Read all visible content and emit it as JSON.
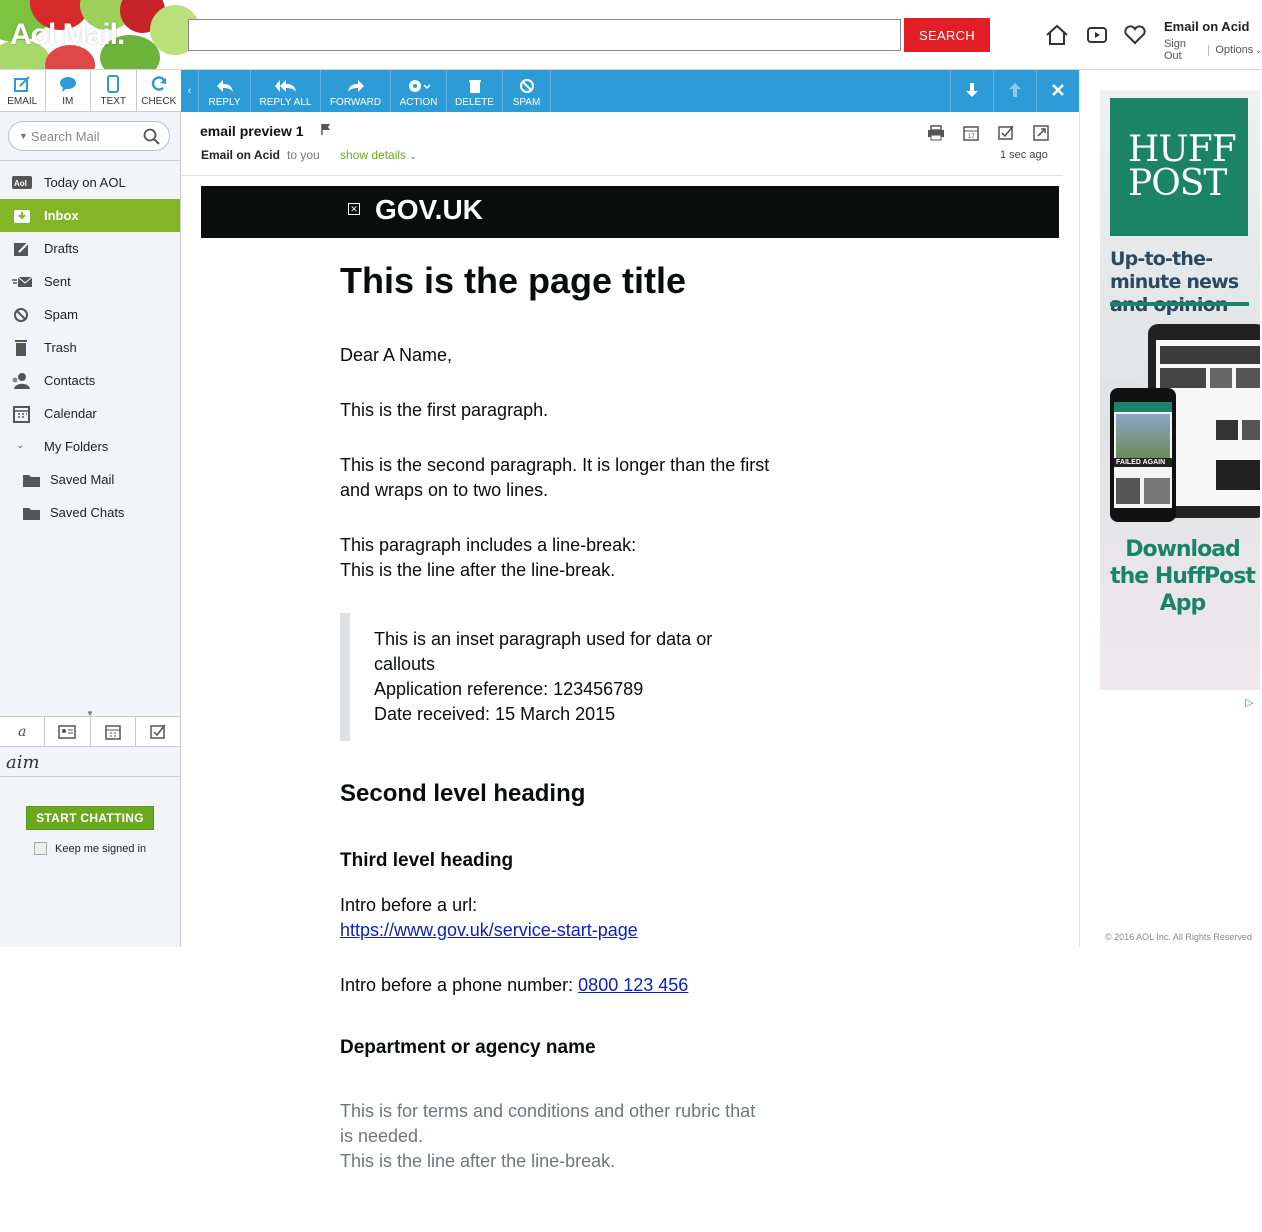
{
  "header": {
    "logo_text": "Aol Mail.",
    "search_button": "SEARCH",
    "search_value": "",
    "user_name": "Email on Acid",
    "sign_out": "Sign Out",
    "options": "Options"
  },
  "compose": [
    {
      "label": "EMAIL",
      "icon": "compose-icon"
    },
    {
      "label": "IM",
      "icon": "chat-bubble-icon"
    },
    {
      "label": "TEXT",
      "icon": "phone-icon"
    },
    {
      "label": "CHECK",
      "icon": "refresh-icon"
    }
  ],
  "toolbar": {
    "reply": "REPLY",
    "reply_all": "REPLY ALL",
    "forward": "FORWARD",
    "action": "ACTION",
    "delete": "DELETE",
    "spam": "SPAM"
  },
  "sidebar": {
    "search_placeholder": "Search Mail",
    "items": [
      {
        "label": "Today on AOL",
        "icon": "aol-icon"
      },
      {
        "label": "Inbox",
        "icon": "inbox-icon",
        "active": true
      },
      {
        "label": "Drafts",
        "icon": "drafts-icon"
      },
      {
        "label": "Sent",
        "icon": "sent-icon"
      },
      {
        "label": "Spam",
        "icon": "spam-icon"
      },
      {
        "label": "Trash",
        "icon": "trash-icon"
      },
      {
        "label": "Contacts",
        "icon": "contacts-icon"
      },
      {
        "label": "Calendar",
        "icon": "calendar-icon"
      },
      {
        "label": "My Folders",
        "icon": "chevron-down-icon"
      },
      {
        "label": "Saved Mail",
        "icon": "folder-icon"
      },
      {
        "label": "Saved Chats",
        "icon": "folder-icon"
      }
    ],
    "aim_logo": "aim",
    "start_chatting": "START CHATTING",
    "keep_signed_in": "Keep me signed in"
  },
  "message": {
    "subject": "email preview 1",
    "from": "Email on Acid",
    "to": "to you",
    "show_details": "show details",
    "time": "1 sec ago"
  },
  "email": {
    "gov_brand": "GOV.UK",
    "title": "This is the page title",
    "greeting": "Dear A Name,",
    "para1": "This is the first paragraph.",
    "para2": "This is the second paragraph. It is longer than the first and wraps on to two lines.",
    "para3_line1": "This paragraph includes a line-break:",
    "para3_line2": "This is the line after the line-break.",
    "inset_line1": "This is an inset paragraph used for data or callouts",
    "inset_line2": "Application reference: 123456789",
    "inset_line3": "Date received: 15 March 2015",
    "h2": "Second level heading",
    "h3": "Third level heading",
    "url_intro": "Intro before a url:",
    "url": "https://www.gov.uk/service-start-page",
    "phone_intro": "Intro before a phone number:",
    "phone": "0800 123 456",
    "dept": "Department or agency name",
    "terms_line1": "This is for terms and conditions and other rubric that is needed.",
    "terms_line2": "This is the line after the line-break."
  },
  "ad": {
    "logo_line1": "HUFF",
    "logo_line2": "POST",
    "tagline": "Up-to-the-minute news and opinion",
    "phone_banner": "FAILED AGAIN",
    "cta": "Download the HuffPost App",
    "copyright": "© 2016 AOL Inc. All Rights Reserved"
  },
  "colors": {
    "toolbar": "#2c9bd6",
    "active_nav": "#84b527",
    "search_button": "#e21f26",
    "huffpost_green": "#1b8467"
  }
}
